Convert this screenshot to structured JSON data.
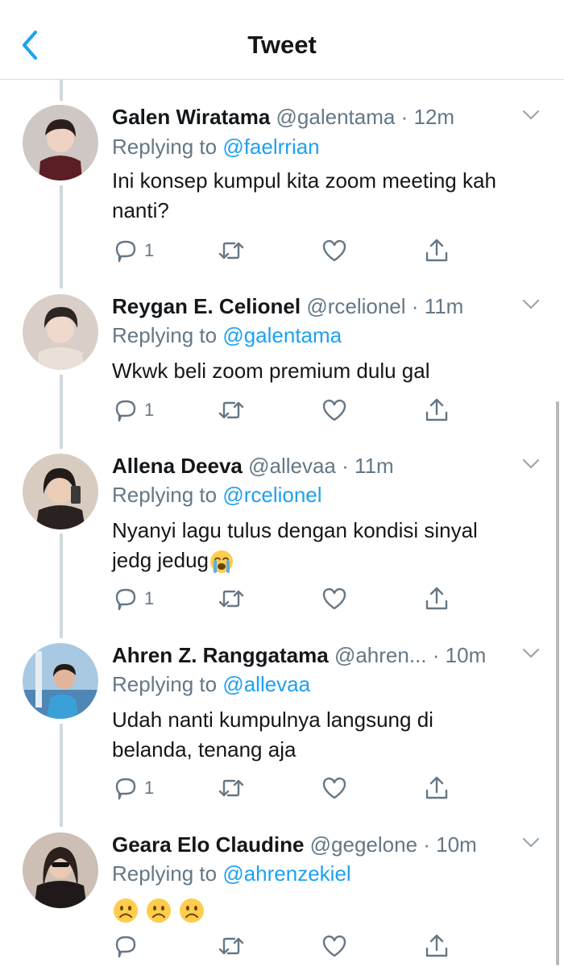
{
  "header": {
    "title": "Tweet"
  },
  "tweets": [
    {
      "name": "Galen Wiratama",
      "handle": "@galentama",
      "dot": "·",
      "time": "12m",
      "replying_label": "Replying to",
      "mention": "@faelrrian",
      "text": "Ini konsep kumpul kita zoom meeting kah nanti?",
      "reply_count": "1"
    },
    {
      "name": "Reygan E. Celionel",
      "handle": "@rcelionel",
      "dot": "·",
      "time": "11m",
      "replying_label": "Replying to",
      "mention": "@galentama",
      "text": "Wkwk beli zoom premium dulu gal",
      "reply_count": "1"
    },
    {
      "name": "Allena Deeva",
      "handle": "@allevaa",
      "dot": "·",
      "time": "11m",
      "replying_label": "Replying to",
      "mention": "@rcelionel",
      "text_line1": "Nyanyi lagu tulus dengan kondisi sinyal",
      "text_line2": "jedg jedug",
      "emoji": "loudly-crying-face",
      "reply_count": "1"
    },
    {
      "name": "Ahren Z. Ranggatama",
      "handle": "@ahren...",
      "dot": "·",
      "time": "10m",
      "replying_label": "Replying to",
      "mention": "@allevaa",
      "text": "Udah nanti kumpulnya langsung di belanda, tenang aja",
      "reply_count": "1"
    },
    {
      "name": "Geara Elo Claudine",
      "handle": "@gegelone",
      "dot": "·",
      "time": "10m",
      "replying_label": "Replying to",
      "mention": "@ahrenzekiel",
      "emoji": "frowning-face x3",
      "reply_count": ""
    }
  ],
  "icons": {
    "back": "chevron-left-icon",
    "more": "chevron-down-icon",
    "reply": "reply-bubble-icon",
    "retweet": "retweet-icon",
    "like": "heart-icon",
    "share": "share-icon"
  },
  "colors": {
    "accent": "#1da1f2",
    "secondary_text": "#657786",
    "primary_text": "#14171a",
    "thread_line": "#cfd9de"
  }
}
